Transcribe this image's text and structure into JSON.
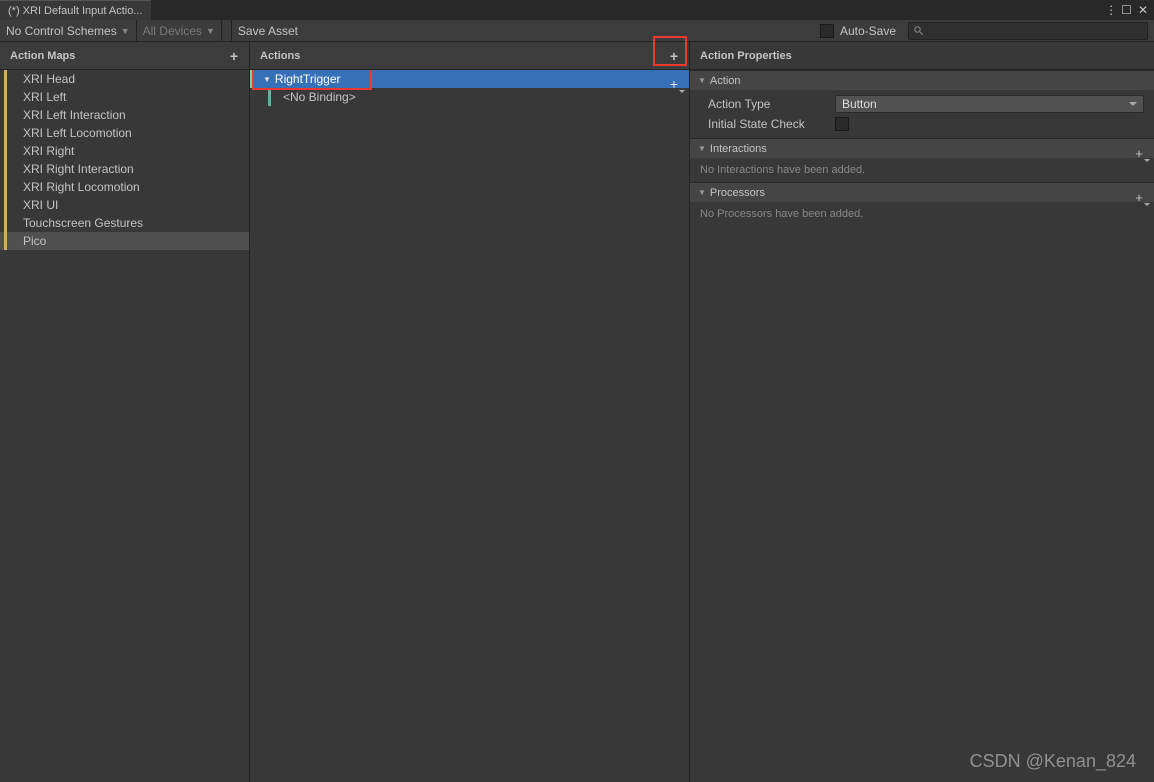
{
  "tab_title": "(*) XRI Default Input Actio...",
  "toolbar": {
    "control_schemes": "No Control Schemes",
    "devices": "All Devices",
    "save": "Save Asset",
    "autosave": "Auto-Save"
  },
  "headers": {
    "action_maps": "Action Maps",
    "actions": "Actions",
    "properties": "Action Properties"
  },
  "action_maps": [
    "XRI Head",
    "XRI Left",
    "XRI Left Interaction",
    "XRI Left Locomotion",
    "XRI Right",
    "XRI Right Interaction",
    "XRI Right Locomotion",
    "XRI UI",
    "Touchscreen Gestures",
    "Pico"
  ],
  "selected_map_index": 9,
  "actions": {
    "selected": "RightTrigger",
    "binding": "<No Binding>"
  },
  "properties": {
    "action_section": "Action",
    "action_type_label": "Action Type",
    "action_type_value": "Button",
    "initial_state_label": "Initial State Check",
    "interactions_section": "Interactions",
    "interactions_empty": "No Interactions have been added.",
    "processors_section": "Processors",
    "processors_empty": "No Processors have been added."
  },
  "watermark": "CSDN @Kenan_824"
}
